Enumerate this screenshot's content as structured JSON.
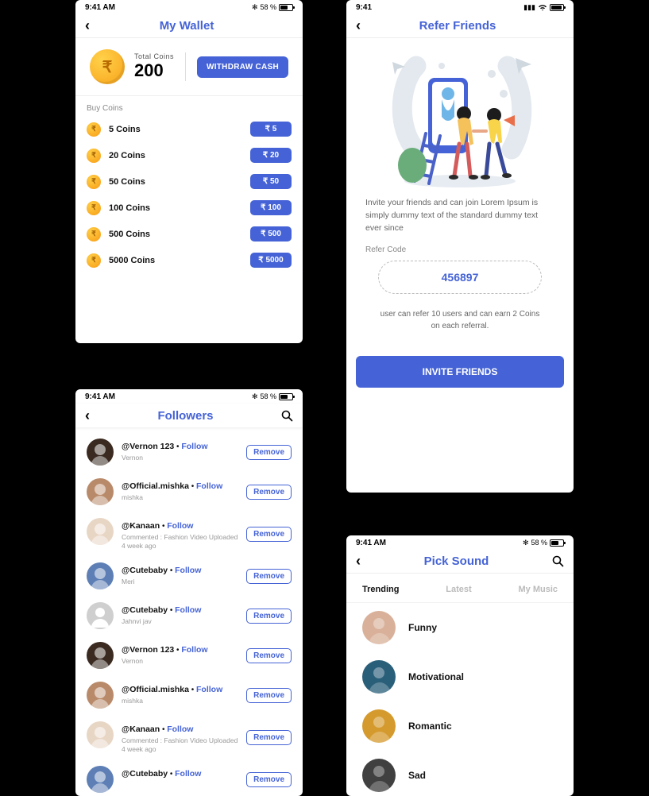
{
  "status": {
    "time": "9:41 AM",
    "battery_text": "58 %",
    "time_simple": "9:41"
  },
  "wallet": {
    "title": "My Wallet",
    "total_label": "Total  Coins",
    "total_value": "200",
    "withdraw_btn": "WITHDRAW CASH",
    "buy_label": "Buy Coins",
    "rows": [
      {
        "label": "5 Coins",
        "price": "₹ 5"
      },
      {
        "label": "20 Coins",
        "price": "₹ 20"
      },
      {
        "label": "50 Coins",
        "price": "₹ 50"
      },
      {
        "label": "100 Coins",
        "price": "₹ 100"
      },
      {
        "label": "500 Coins",
        "price": "₹ 500"
      },
      {
        "label": "5000 Coins",
        "price": "₹ 5000"
      }
    ]
  },
  "refer": {
    "title": "Refer Friends",
    "desc": "Invite your friends and can join Lorem Ipsum is simply dummy text of the standard dummy text ever since",
    "code_label": "Refer Code",
    "code": "456897",
    "note": "user can refer 10 users and can earn 2 Coins on each referral.",
    "invite_btn": "INVITE FRIENDS"
  },
  "followers": {
    "title": "Followers",
    "follow_text": "Follow",
    "remove_text": "Remove",
    "items": [
      {
        "handle": "@Vernon 123",
        "name": "Vernon",
        "extra": "",
        "bgcolor": "#3a2a20"
      },
      {
        "handle": "@Official.mishka",
        "name": "mishka",
        "extra": "",
        "bgcolor": "#b98a6a"
      },
      {
        "handle": "@Kanaan",
        "name": "",
        "extra": "Commented : Fashion Video Uploaded",
        "extra2": "4 week ago",
        "bgcolor": "#e8d6c5"
      },
      {
        "handle": "@Cutebaby",
        "name": "Meri",
        "extra": "",
        "bgcolor": "#5d7fb5"
      },
      {
        "handle": "@Cutebaby",
        "name": "Jahnvi jav",
        "extra": "",
        "bgcolor": "#cfcfcf",
        "placeholder": true
      },
      {
        "handle": "@Vernon 123",
        "name": "Vernon",
        "extra": "",
        "bgcolor": "#3a2a20"
      },
      {
        "handle": "@Official.mishka",
        "name": "mishka",
        "extra": "",
        "bgcolor": "#b98a6a"
      },
      {
        "handle": "@Kanaan",
        "name": "",
        "extra": "Commented : Fashion Video Uploaded",
        "extra2": "4 week ago",
        "bgcolor": "#e8d6c5"
      },
      {
        "handle": "@Cutebaby",
        "name": "",
        "extra": "",
        "bgcolor": "#5d7fb5"
      }
    ]
  },
  "sounds": {
    "title": "Pick Sound",
    "tabs": [
      "Trending",
      "Latest",
      "My Music"
    ],
    "active_tab": 0,
    "items": [
      {
        "name": "Funny",
        "bgcolor": "#d9b19a"
      },
      {
        "name": "Motivational",
        "bgcolor": "#2a5f7a"
      },
      {
        "name": "Romantic",
        "bgcolor": "#d59a2d"
      },
      {
        "name": "Sad",
        "bgcolor": "#404040"
      }
    ]
  }
}
